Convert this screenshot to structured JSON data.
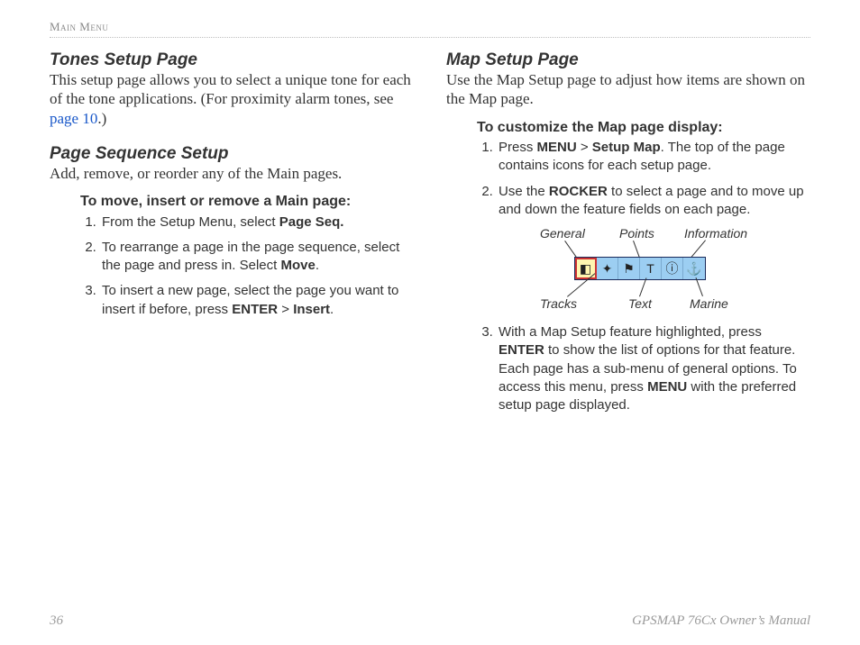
{
  "running_head": "Main Menu",
  "left": {
    "h1": "Tones Setup Page",
    "p1_a": "This setup page allows you to select a unique tone for each of the tone applications. (For proximity alarm tones, see ",
    "p1_link": "page 10",
    "p1_b": ".)",
    "h2": "Page Sequence Setup",
    "p2": "Add, remove, or reorder any of the Main pages.",
    "proc_head": "To move, insert or remove a Main page:",
    "s1_a": "From the Setup Menu, select ",
    "s1_b": "Page Seq.",
    "s2_a": "To rearrange a page in the page sequence, select the page and press in. Select ",
    "s2_b": "Move",
    "s2_c": ".",
    "s3_a": "To insert a new page, select the page you want to insert if before, press ",
    "s3_b": "ENTER",
    "s3_c": " > ",
    "s3_d": "Insert",
    "s3_e": "."
  },
  "right": {
    "h1": "Map Setup Page",
    "p1": "Use the Map Setup page to adjust how items are shown on the Map page.",
    "proc_head": "To customize the Map page display:",
    "s1_a": "Press ",
    "s1_b": "MENU",
    "s1_c": " > ",
    "s1_d": "Setup Map",
    "s1_e": ". The top of the page contains icons for each setup page.",
    "s2_a": "Use the ",
    "s2_b": "ROCKER",
    "s2_c": " to select a page and to move up and down the feature fields on each page.",
    "s3_a": "With a Map Setup feature highlighted, press ",
    "s3_b": "ENTER",
    "s3_c": " to show the list of options for that feature. Each page has a sub-menu of general options. To access this menu, press ",
    "s3_d": "MENU",
    "s3_e": " with the preferred setup page displayed."
  },
  "diagram": {
    "labels_top": [
      "General",
      "Points",
      "Information"
    ],
    "labels_bottom": [
      "Tracks",
      "Text",
      "Marine"
    ],
    "icons": [
      "◧",
      "✦",
      "⚑",
      "T",
      "ⓘ",
      "⚓"
    ]
  },
  "footer": {
    "page": "36",
    "title": "GPSMAP 76Cx Owner’s Manual"
  }
}
